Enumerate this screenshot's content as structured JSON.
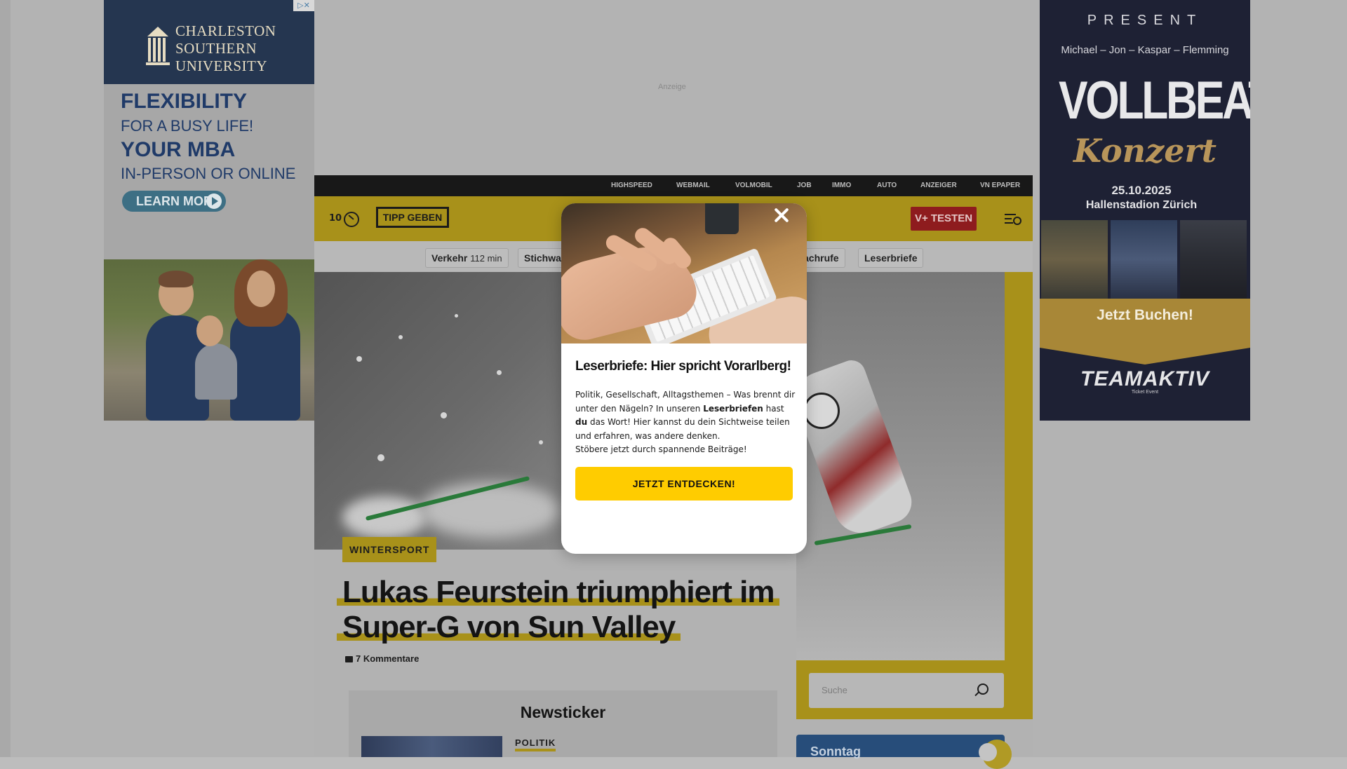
{
  "ads": {
    "top_label": "Anzeige",
    "left": {
      "university": [
        "CHARLESTON",
        "SOUTHERN",
        "UNIVERSITY"
      ],
      "line1": "FLEXIBILITY",
      "line2": "FOR A BUSY LIFE!",
      "line3": "YOUR MBA",
      "line4": "IN-PERSON OR ONLINE",
      "cta": "LEARN MORE",
      "adchoices": "▷✕",
      "brand_color": "#253650"
    },
    "right": {
      "present": "PRESENT",
      "band": "Michael – Jon – Kaspar – Flemming",
      "title": "VOLLBEAT",
      "subtitle": "Konzert",
      "date": "25.10.2025",
      "venue": "Hallenstadion Zürich",
      "cta": "Jetzt Buchen!",
      "logo_a": "TEAM",
      "logo_b": "AKTIV",
      "logo_sub": "Ticket Event"
    }
  },
  "site": {
    "topnav": [
      "HIGHSPEED",
      "WEBMAIL",
      "VOLMOBIL",
      "JOB",
      "IMMO",
      "AUTO",
      "ANZEIGER",
      "VN EPAPER"
    ],
    "header": {
      "count": "10",
      "tipp_label": "TIPP GEBEN",
      "vplus_label": "V+ TESTEN"
    },
    "tags": [
      {
        "label": "Verkehr",
        "meta": "112 min"
      },
      {
        "label": "Stichwa",
        "meta": ""
      },
      {
        "label": "achrufe",
        "meta": ""
      },
      {
        "label": "Leserbriefe",
        "meta": ""
      }
    ],
    "article": {
      "category": "WINTERSPORT",
      "headline_line1": "Lukas Feurstein triumphiert im",
      "headline_line2": "Super-G von Sun Valley",
      "comments": "7 Kommentare"
    },
    "search": {
      "placeholder": "Suche"
    },
    "weather": {
      "label": "Sonntag"
    },
    "newsticker": {
      "title": "Newsticker",
      "first_category": "POLITIK"
    },
    "colors": {
      "accent": "#ffcc00",
      "vplus": "#c8102e",
      "topbar": "#181818"
    }
  },
  "modal": {
    "title": "Leserbriefe: Hier spricht Vorarlberg!",
    "text_a": "Politik, Gesellschaft, Alltagsthemen – Was brennt dir unter den Nägeln? In unseren ",
    "text_bold1": "Leserbriefen",
    "text_b": " hast ",
    "text_bold2": "du",
    "text_c": " das Wort! Hier kannst du dein Sichtweise teilen und erfahren, was andere denken.",
    "text_d": "Stöbere jetzt durch spannende Beiträge!",
    "button": "JETZT ENTDECKEN!",
    "close_icon": "close-icon"
  }
}
